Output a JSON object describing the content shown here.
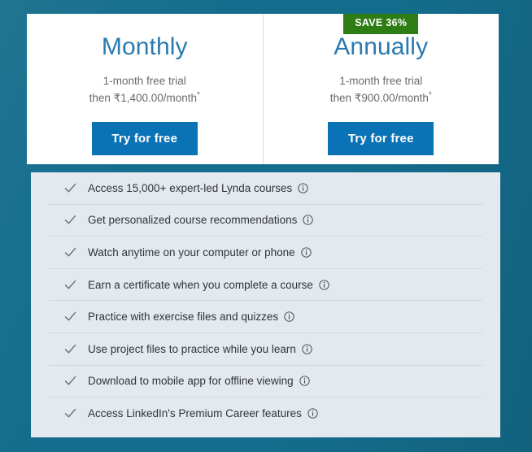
{
  "background": {
    "base_color": "#146d8c"
  },
  "pricing": {
    "plans": [
      {
        "title": "Monthly",
        "trial": "1-month free trial",
        "price_line": "then ₹1,400.00/month",
        "price_asterisk": "*",
        "cta_label": "Try for free",
        "badge": null
      },
      {
        "title": "Annually",
        "trial": "1-month free trial",
        "price_line": "then ₹900.00/month",
        "price_asterisk": "*",
        "cta_label": "Try for free",
        "badge": "SAVE 36%"
      }
    ],
    "accent_blue": "#0a73b5",
    "badge_green": "#2e7d14",
    "title_blue": "#2a7ab0"
  },
  "features": {
    "items": [
      {
        "label": "Access 15,000+ expert-led Lynda courses",
        "check": "check-icon",
        "info": "info-icon"
      },
      {
        "label": "Get personalized course recommendations",
        "check": "check-icon",
        "info": "info-icon"
      },
      {
        "label": "Watch anytime on your computer or phone",
        "check": "check-icon",
        "info": "info-icon"
      },
      {
        "label": "Earn a certificate when you complete a course",
        "check": "check-icon",
        "info": "info-icon"
      },
      {
        "label": "Practice with exercise files and quizzes",
        "check": "check-icon",
        "info": "info-icon"
      },
      {
        "label": "Use project files to practice while you learn",
        "check": "check-icon",
        "info": "info-icon"
      },
      {
        "label": "Download to mobile app for offline viewing",
        "check": "check-icon",
        "info": "info-icon"
      },
      {
        "label": "Access LinkedIn's Premium Career features",
        "check": "check-icon",
        "info": "info-icon"
      }
    ]
  }
}
